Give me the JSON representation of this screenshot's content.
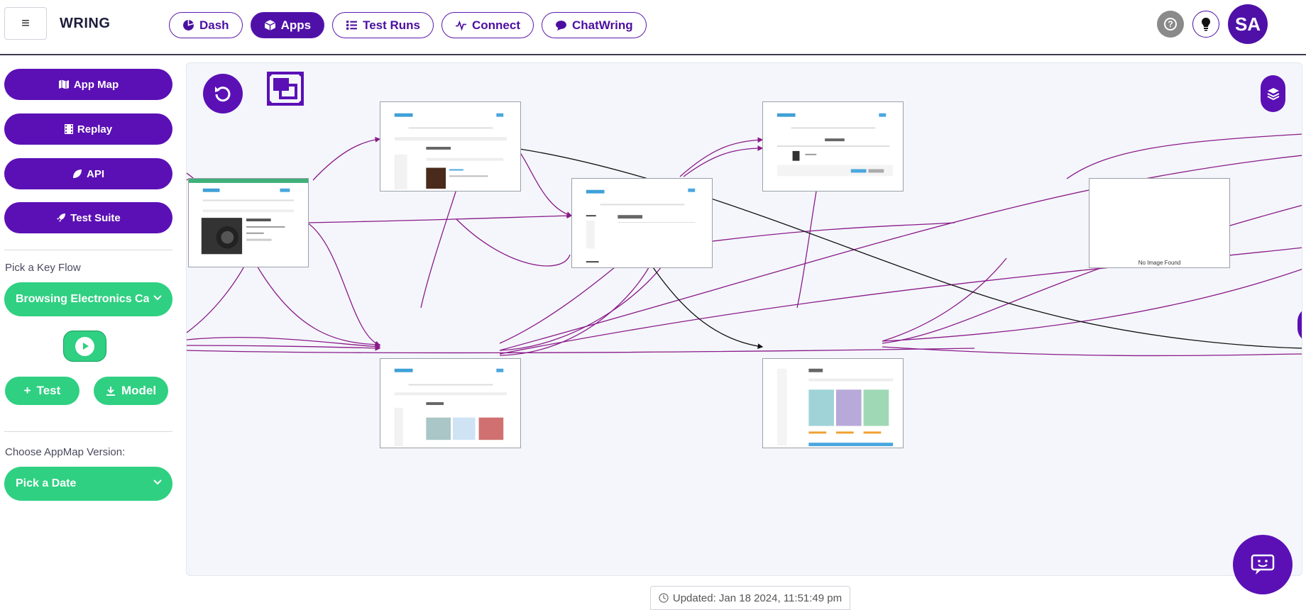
{
  "header": {
    "brand": "WRING",
    "nav": [
      {
        "label": "Dash",
        "icon": "pie-chart-icon",
        "active": false
      },
      {
        "label": "Apps",
        "icon": "cube-icon",
        "active": true
      },
      {
        "label": "Test Runs",
        "icon": "list-icon",
        "active": false
      },
      {
        "label": "Connect",
        "icon": "pulse-icon",
        "active": false
      },
      {
        "label": "ChatWring",
        "icon": "chat-bubble-icon",
        "active": false
      }
    ],
    "avatar_initials": "SA",
    "help_glyph": "?"
  },
  "sidebar": {
    "buttons": [
      {
        "label": "App Map",
        "icon": "map-icon"
      },
      {
        "label": "Replay",
        "icon": "film-icon"
      },
      {
        "label": "API",
        "icon": "leaf-icon"
      },
      {
        "label": "Test Suite",
        "icon": "rocket-icon"
      }
    ],
    "key_flow_label": "Pick a Key Flow",
    "key_flow_value": "Browsing Electronics Ca",
    "test_label": "Test",
    "model_label": "Model",
    "version_label": "Choose AppMap Version:",
    "version_value": "Pick a Date"
  },
  "canvas": {
    "empty_node_text": "No Image Found"
  },
  "footer": {
    "updated": "Updated: Jan 18 2024, 11:51:49 pm"
  },
  "colors": {
    "primary": "#5b10b5",
    "green": "#2fd081",
    "edge_purple": "#8b1a89",
    "edge_black": "#111111"
  }
}
